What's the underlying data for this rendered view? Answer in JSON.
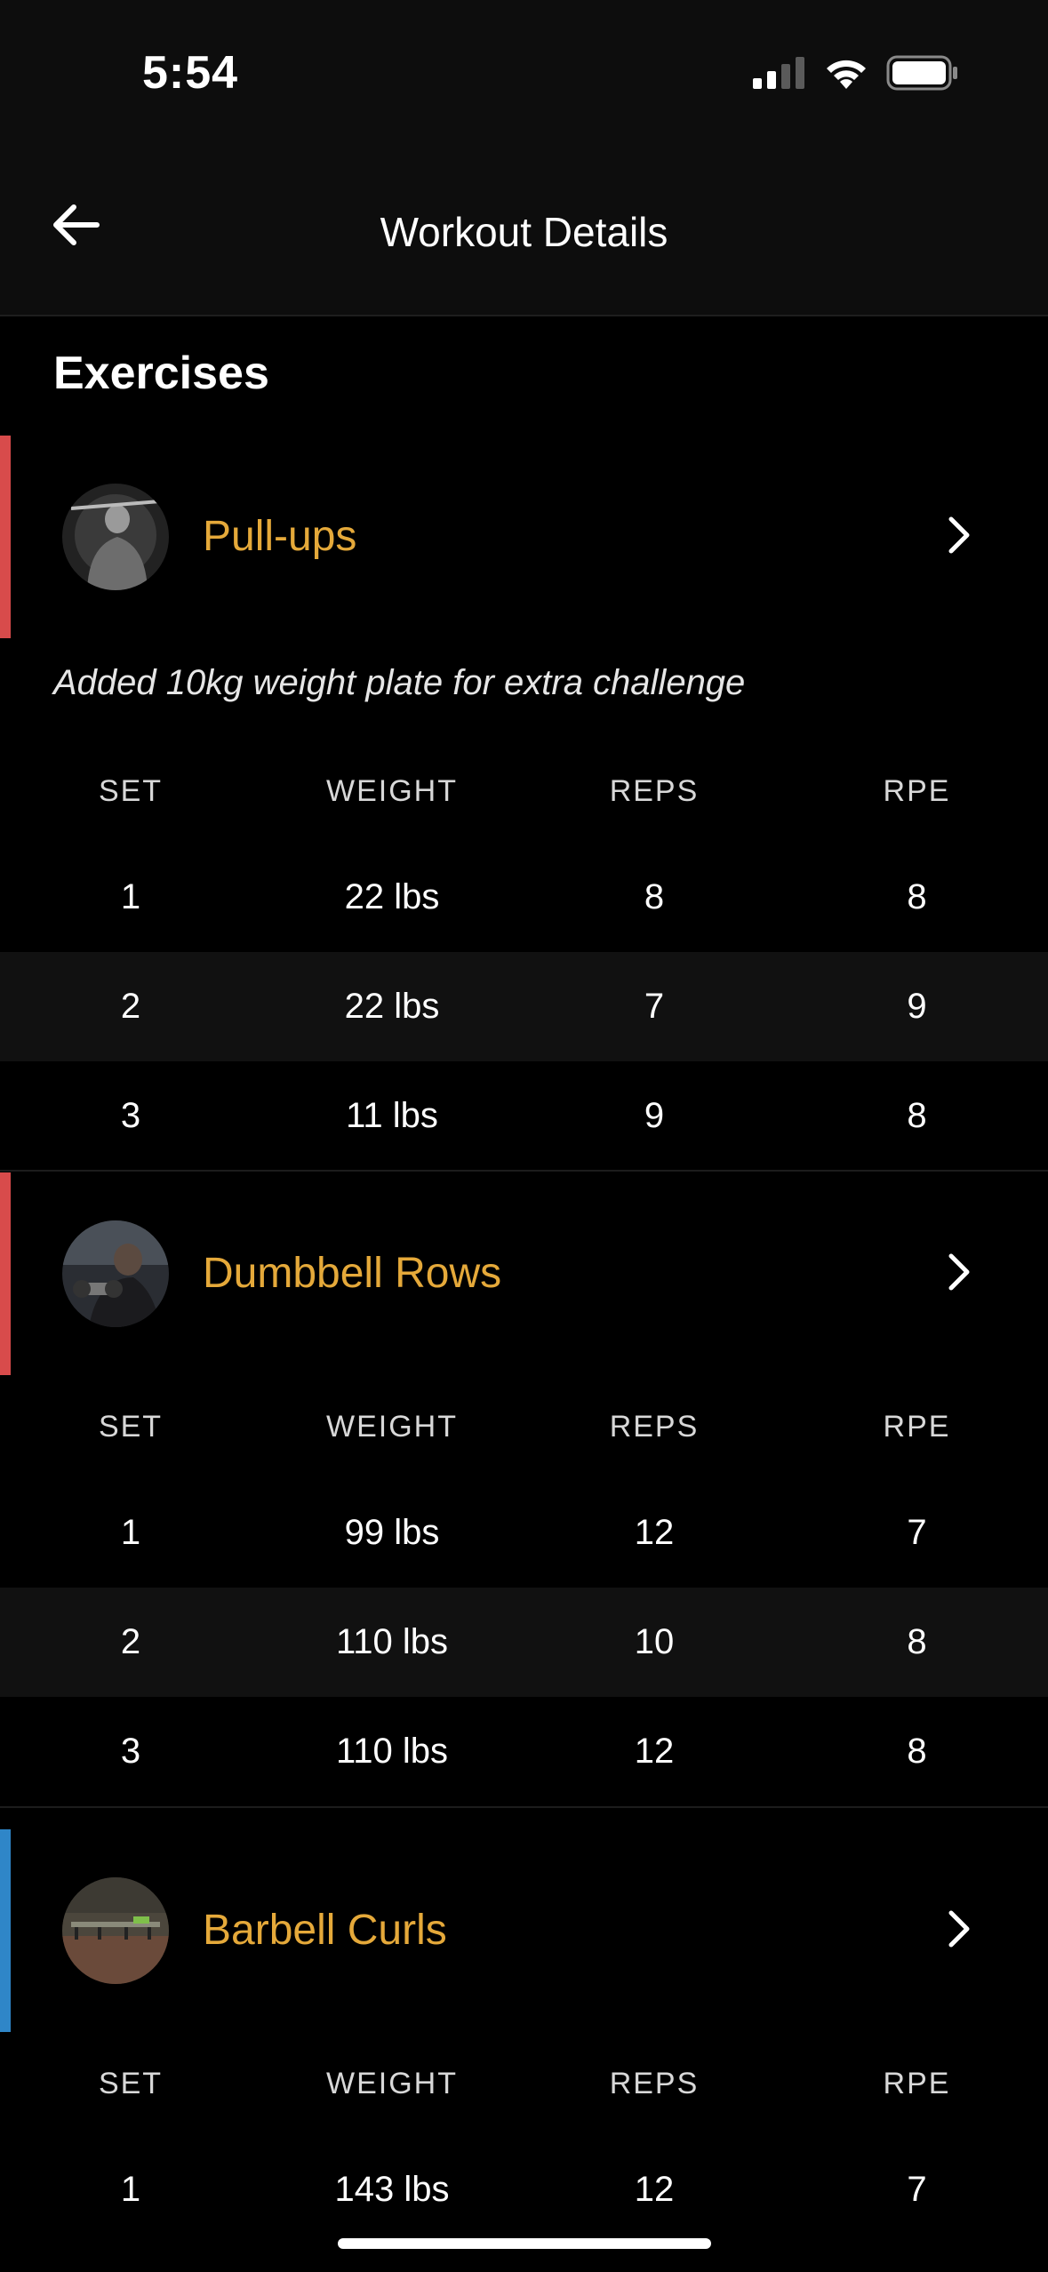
{
  "status_bar": {
    "time": "5:54"
  },
  "nav": {
    "title": "Workout Details"
  },
  "section_title": "Exercises",
  "table_headers": {
    "set": "SET",
    "weight": "WEIGHT",
    "reps": "REPS",
    "rpe": "RPE"
  },
  "exercises": [
    {
      "name": "Pull-ups",
      "note": "Added 10kg weight plate for extra challenge",
      "accent_color": "#d84b4b",
      "sets": [
        {
          "set": "1",
          "weight": "22 lbs",
          "reps": "8",
          "rpe": "8"
        },
        {
          "set": "2",
          "weight": "22 lbs",
          "reps": "7",
          "rpe": "9"
        },
        {
          "set": "3",
          "weight": "11 lbs",
          "reps": "9",
          "rpe": "8"
        }
      ]
    },
    {
      "name": "Dumbbell Rows",
      "accent_color": "#d84b4b",
      "sets": [
        {
          "set": "1",
          "weight": "99 lbs",
          "reps": "12",
          "rpe": "7"
        },
        {
          "set": "2",
          "weight": "110 lbs",
          "reps": "10",
          "rpe": "8"
        },
        {
          "set": "3",
          "weight": "110 lbs",
          "reps": "12",
          "rpe": "8"
        }
      ]
    },
    {
      "name": "Barbell Curls",
      "accent_color": "#2f86c8",
      "sets": [
        {
          "set": "1",
          "weight": "143 lbs",
          "reps": "12",
          "rpe": "7"
        }
      ]
    }
  ],
  "colors": {
    "exercise_name": "#e5a93a",
    "background": "#000000",
    "alt_row": "#111111"
  }
}
